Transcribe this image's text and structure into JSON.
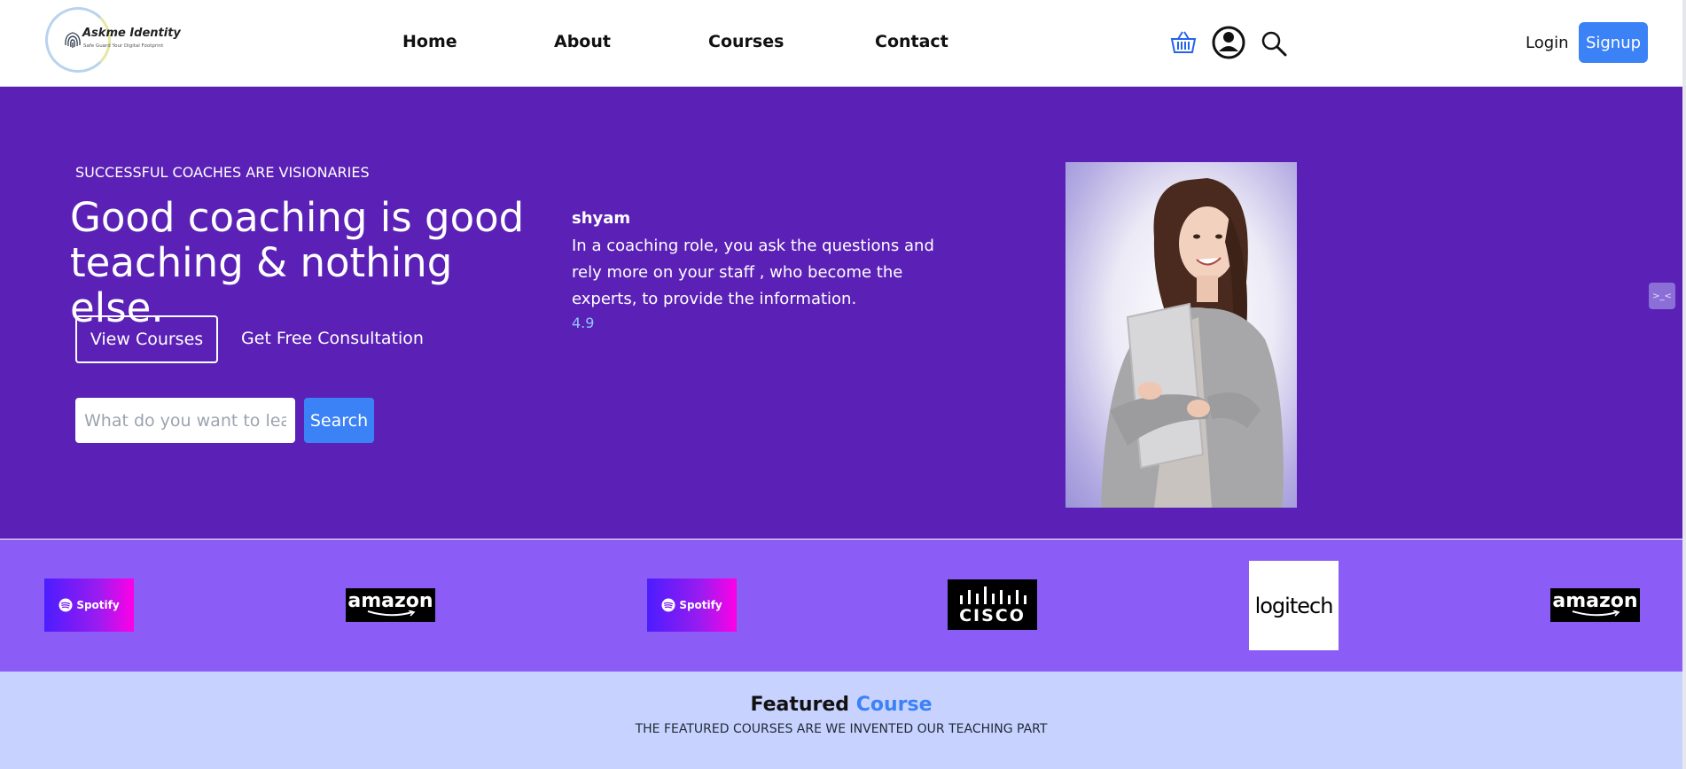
{
  "header": {
    "logo_name": "Askme Identity",
    "logo_tagline": "Safe Guard Your Digital Footprint",
    "nav": [
      "Home",
      "About",
      "Courses",
      "Contact"
    ],
    "icons": {
      "cart": "basket-icon",
      "account": "user-circle-icon",
      "search": "search-icon"
    },
    "login": "Login",
    "signup": "Signup"
  },
  "hero": {
    "eyebrow": "SUCCESSFUL COACHES ARE VISIONARIES",
    "title": "Good coaching is good teaching & nothing else.",
    "view_courses": "View Courses",
    "free_consultation": "Get Free Consultation",
    "search_placeholder": "What do you want to learn",
    "search_button": "Search",
    "testimonial": {
      "name": "shyam",
      "quote": "In a coaching role, you ask the questions and rely more on your staff , who become the experts, to provide the information.",
      "rating": "4.9"
    },
    "side_tab": ">_<"
  },
  "brands": [
    {
      "name": "Spotify",
      "label": "Spotify"
    },
    {
      "name": "Amazon",
      "label": "amazon"
    },
    {
      "name": "Spotify",
      "label": "Spotify"
    },
    {
      "name": "Cisco",
      "label": "CISCO"
    },
    {
      "name": "Logitech",
      "label": "logitech"
    },
    {
      "name": "Amazon",
      "label": "amazon"
    }
  ],
  "featured": {
    "title_main": "Featured",
    "title_accent": "Course",
    "subtitle": "THE FEATURED COURSES ARE WE INVENTED OUR TEACHING PART"
  },
  "colors": {
    "hero_bg": "#5b21b6",
    "logos_bg": "#8b5cf6",
    "featured_bg": "#c7d2fe",
    "accent": "#3b82f6"
  }
}
